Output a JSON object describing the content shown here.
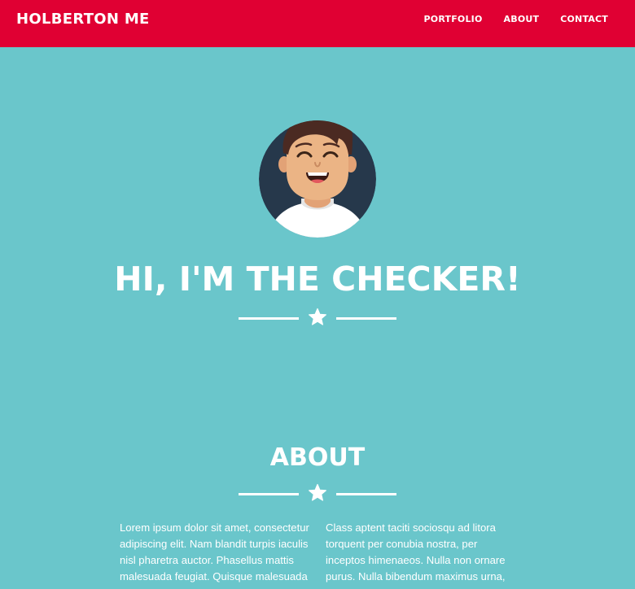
{
  "header": {
    "brand": "HOLBERTON ME",
    "nav": [
      {
        "label": "PORTFOLIO"
      },
      {
        "label": "ABOUT"
      },
      {
        "label": "CONTACT"
      }
    ]
  },
  "hero": {
    "title": "HI, I'M THE CHECKER!",
    "avatar_icon": "person-avatar",
    "divider_icon": "star-icon"
  },
  "about": {
    "title": "ABOUT",
    "divider_icon": "star-icon",
    "col1": "Lorem ipsum dolor sit amet, consectetur adipiscing elit. Nam blandit turpis iaculis nisl pharetra auctor. Phasellus mattis malesuada feugiat. Quisque malesuada",
    "col2": "Class aptent taciti sociosqu ad litora torquent per conubia nostra, per inceptos himenaeos. Nulla non ornare purus. Nulla bibendum maximus urna,"
  },
  "colors": {
    "header_bg": "#e00033",
    "page_bg": "#6ac6cb",
    "text": "#ffffff"
  }
}
